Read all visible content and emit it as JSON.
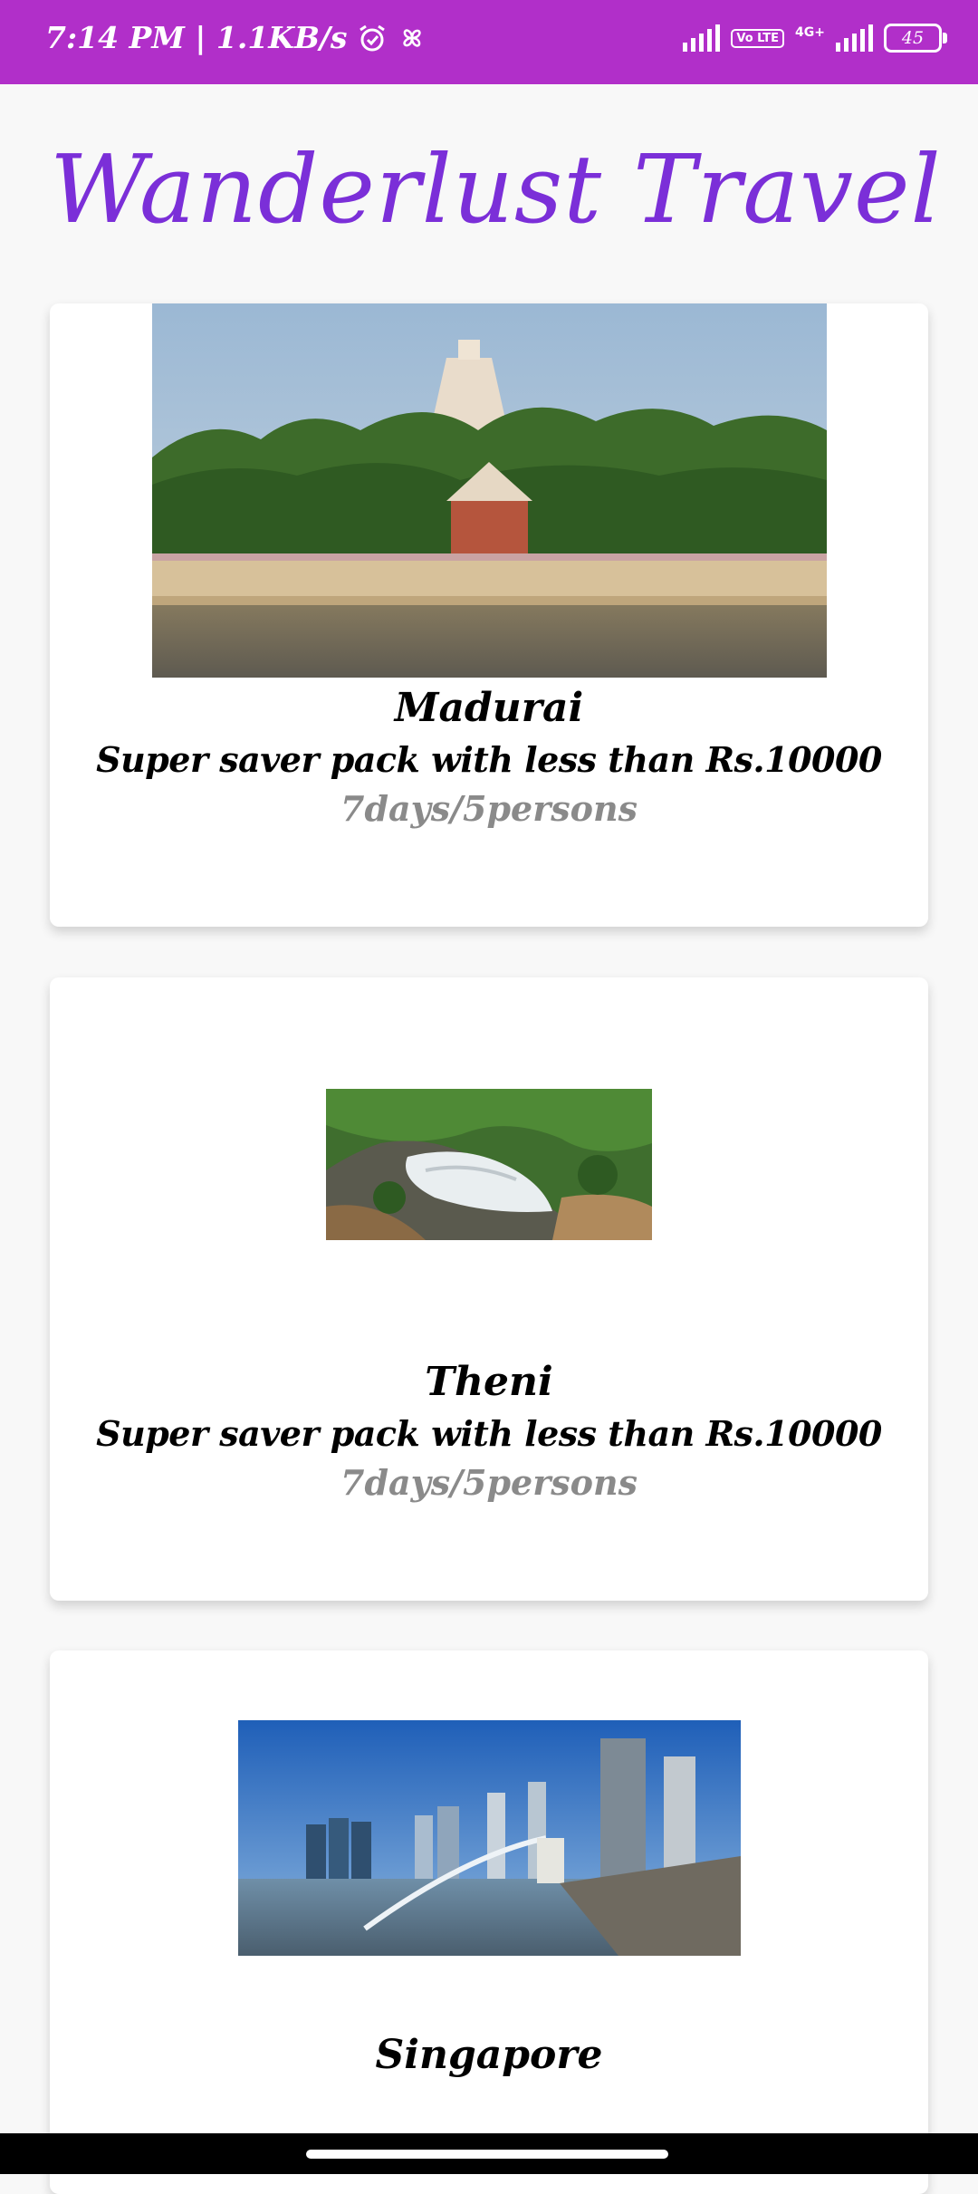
{
  "status_bar": {
    "time_speed": "7:14 PM | 1.1KB/s",
    "network": "4G+",
    "volte": "Vo LTE",
    "battery": "45"
  },
  "app": {
    "title": "Wanderlust Travel"
  },
  "packages": [
    {
      "place": "Madurai",
      "offer": "Super saver pack with less than Rs.10000",
      "duration": "7days/5persons"
    },
    {
      "place": "Theni",
      "offer": "Super saver pack with less than Rs.10000",
      "duration": "7days/5persons"
    },
    {
      "place": "Singapore"
    }
  ]
}
